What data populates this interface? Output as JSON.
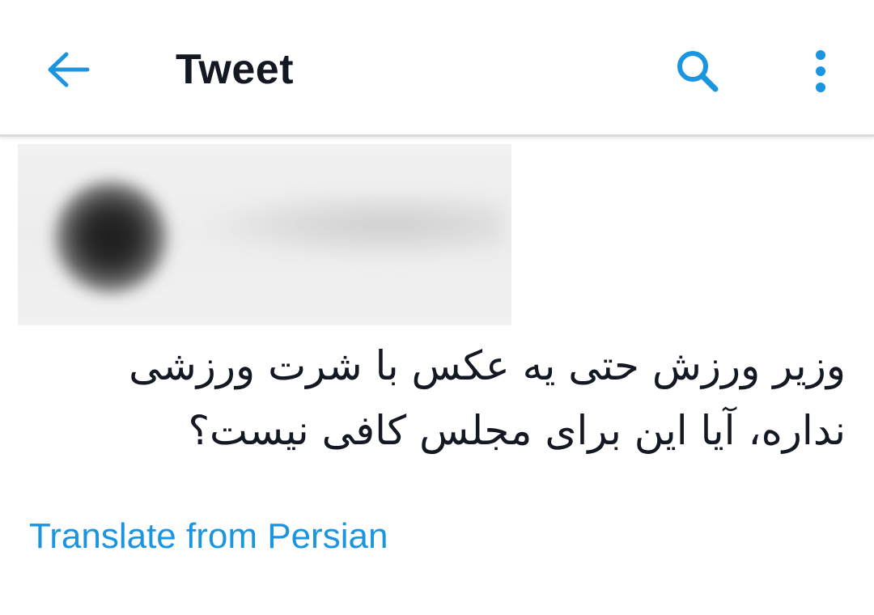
{
  "colors": {
    "accent": "#1b95e0",
    "text": "#141823",
    "background": "#ffffff",
    "divider": "#dadada"
  },
  "header": {
    "title": "Tweet",
    "back_icon": "arrow-left-icon",
    "search_icon": "search-icon",
    "menu_icon": "more-vertical-icon"
  },
  "tweet": {
    "text": "وزیر ورزش حتی یه عکس با شرت ورزشی نداره، آیا این برای مجلس کافی نیست؟",
    "translate_label": "Translate from Persian"
  }
}
